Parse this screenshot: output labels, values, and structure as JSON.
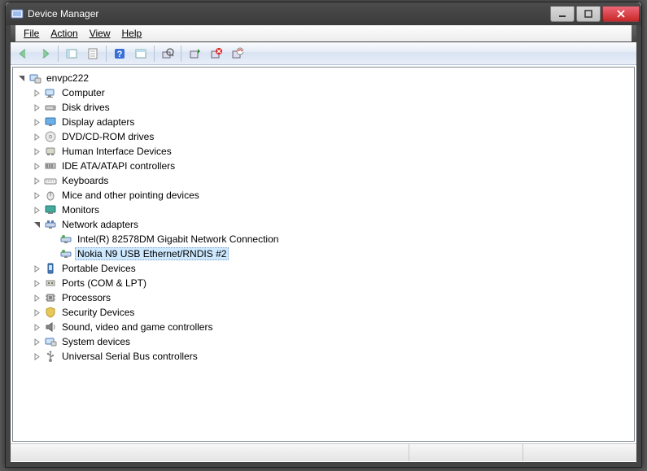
{
  "window": {
    "title": "Device Manager"
  },
  "menu": {
    "file": "File",
    "action": "Action",
    "view": "View",
    "help": "Help"
  },
  "root": {
    "label": "envpc222"
  },
  "nodes": [
    {
      "icon": "computer",
      "label": "Computer"
    },
    {
      "icon": "disk",
      "label": "Disk drives"
    },
    {
      "icon": "display",
      "label": "Display adapters"
    },
    {
      "icon": "dvd",
      "label": "DVD/CD-ROM drives"
    },
    {
      "icon": "hid",
      "label": "Human Interface Devices"
    },
    {
      "icon": "ide",
      "label": "IDE ATA/ATAPI controllers"
    },
    {
      "icon": "keyboard",
      "label": "Keyboards"
    },
    {
      "icon": "mouse",
      "label": "Mice and other pointing devices"
    },
    {
      "icon": "monitor",
      "label": "Monitors"
    },
    {
      "icon": "network",
      "label": "Network adapters",
      "expanded": true
    },
    {
      "icon": "portable",
      "label": "Portable Devices"
    },
    {
      "icon": "ports",
      "label": "Ports (COM & LPT)"
    },
    {
      "icon": "cpu",
      "label": "Processors"
    },
    {
      "icon": "security",
      "label": "Security Devices"
    },
    {
      "icon": "sound",
      "label": "Sound, video and game controllers"
    },
    {
      "icon": "system",
      "label": "System devices"
    },
    {
      "icon": "usb",
      "label": "Universal Serial Bus controllers"
    }
  ],
  "network_children": [
    {
      "label": "Intel(R) 82578DM Gigabit Network Connection",
      "selected": false
    },
    {
      "label": "Nokia N9 USB Ethernet/RNDIS #2",
      "selected": true
    }
  ]
}
